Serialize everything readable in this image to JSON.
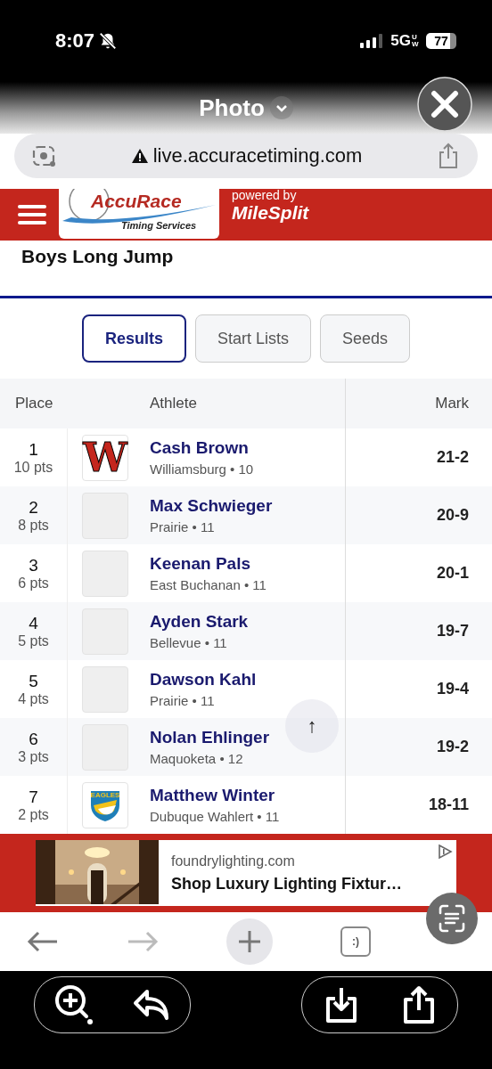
{
  "status_bar": {
    "time": "8:07",
    "silenced": true,
    "network": "5G",
    "network_suffix": "UW",
    "battery": "77"
  },
  "viewer": {
    "title": "Photo"
  },
  "address_bar": {
    "url": "live.accuracetiming.com",
    "insecure": true
  },
  "site_header": {
    "logo_name": "AccuRace",
    "logo_tagline": "Timing Services",
    "powered_label": "powered by",
    "partner": "MileSplit"
  },
  "page_title": "Boys Long Jump",
  "tabs": [
    {
      "label": "Results",
      "selected": true
    },
    {
      "label": "Start Lists",
      "selected": false
    },
    {
      "label": "Seeds",
      "selected": false
    }
  ],
  "table": {
    "columns": [
      "Place",
      "Athlete",
      "Mark"
    ],
    "rows": [
      {
        "place": "1",
        "points": "10 pts",
        "logo": {
          "kind": "letter",
          "text": "W"
        },
        "name": "Cash Brown",
        "team": "Williamsburg • 10",
        "mark": "21-2"
      },
      {
        "place": "2",
        "points": "8 pts",
        "logo": {
          "kind": "blank"
        },
        "name": "Max Schwieger",
        "team": "Prairie • 11",
        "mark": "20-9"
      },
      {
        "place": "3",
        "points": "6 pts",
        "logo": {
          "kind": "blank"
        },
        "name": "Keenan Pals",
        "team": "East Buchanan • 11",
        "mark": "20-1"
      },
      {
        "place": "4",
        "points": "5 pts",
        "logo": {
          "kind": "blank"
        },
        "name": "Ayden Stark",
        "team": "Bellevue • 11",
        "mark": "19-7"
      },
      {
        "place": "5",
        "points": "4 pts",
        "logo": {
          "kind": "blank"
        },
        "name": "Dawson Kahl",
        "team": "Prairie • 11",
        "mark": "19-4"
      },
      {
        "place": "6",
        "points": "3 pts",
        "logo": {
          "kind": "blank"
        },
        "name": "Nolan Ehlinger",
        "team": "Maquoketa • 12",
        "mark": "19-2"
      },
      {
        "place": "7",
        "points": "2 pts",
        "logo": {
          "kind": "shield",
          "text": "EAGLES"
        },
        "name": "Matthew Winter",
        "team": "Dubuque Wahlert • 11",
        "mark": "18-11"
      }
    ]
  },
  "scroll_top_button": {
    "label": "↑"
  },
  "ad": {
    "domain": "foundrylighting.com",
    "headline": "Shop Luxury Lighting Fixtur…"
  },
  "browser_toolbar": {
    "tabs_label": ":)"
  }
}
